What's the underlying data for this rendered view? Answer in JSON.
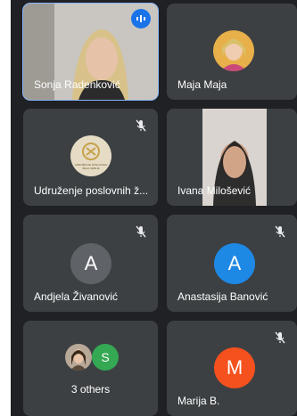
{
  "participants": [
    {
      "name": "Sonja Radenković",
      "speaking": true
    },
    {
      "name": "Maja Maja"
    },
    {
      "name": "Udruženje poslovnih ž...",
      "logo_text": "UDRUŽENJE POSLOVNIH ŽENA SRBIJE"
    },
    {
      "name": "Ivana Milošević"
    },
    {
      "name": "Andjela Živanović",
      "initial": "A"
    },
    {
      "name": "Anastasija Banović",
      "initial": "A"
    },
    {
      "name": "3 others",
      "initial": "S"
    },
    {
      "name": "Marija B.",
      "initial": "M"
    }
  ],
  "colors": {
    "tile_bg": "#3c4043",
    "active_border": "#8ab4f8",
    "speaking_badge": "#1a73e8",
    "avatar_andjela": "#5f6368",
    "avatar_anastasija": "#1e88e5",
    "avatar_s": "#34a853",
    "avatar_marija": "#f4511e"
  }
}
